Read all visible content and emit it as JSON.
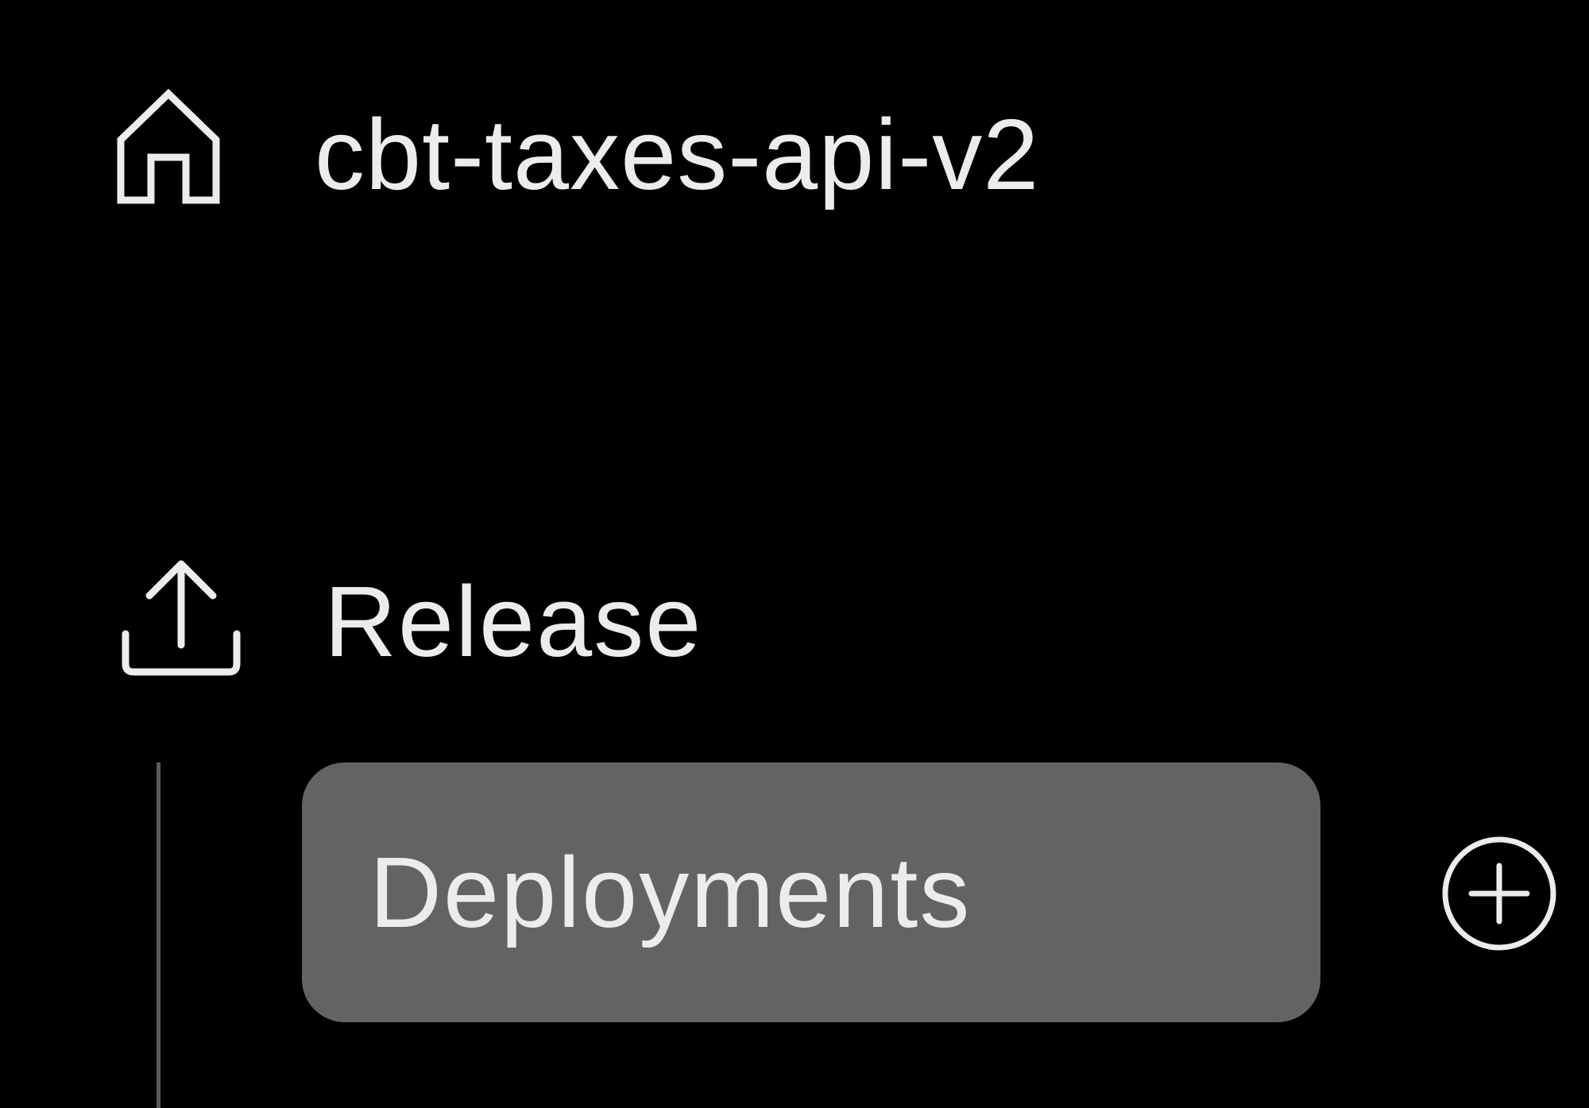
{
  "sidebar": {
    "home": {
      "icon": "home-icon",
      "label": "cbt-taxes-api-v2"
    },
    "release": {
      "icon": "upload-icon",
      "label": "Release"
    },
    "items": [
      {
        "label": "Deployments",
        "selected": true,
        "action_icon": "add-circle-icon"
      }
    ]
  },
  "colors": {
    "background": "#000000",
    "text": "#ececec",
    "selected_item_bg": "#636363",
    "tree_line": "#5c5c5c"
  }
}
